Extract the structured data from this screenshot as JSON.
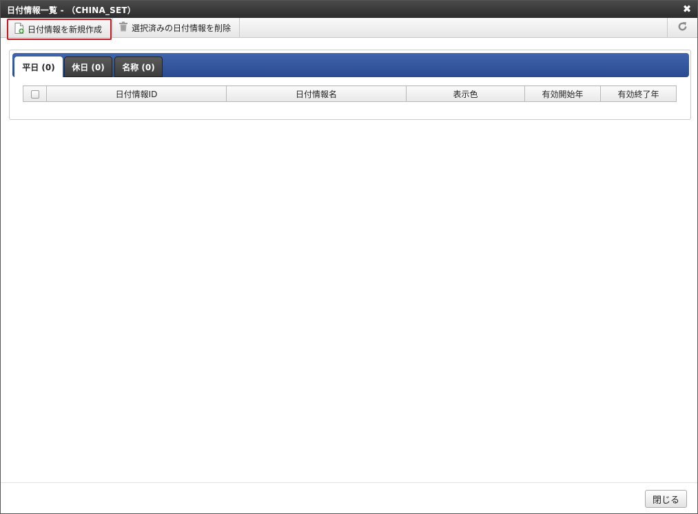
{
  "window": {
    "title": "日付情報一覧 - （CHINA_SET）",
    "close_icon": "close-icon"
  },
  "toolbar": {
    "new_label": "日付情報を新規作成",
    "new_icon": "new-document-icon",
    "delete_label": "選択済みの日付情報を削除",
    "delete_icon": "trash-icon",
    "refresh_icon": "refresh-icon",
    "highlight_color": "#c8161d"
  },
  "tabs": [
    {
      "label": "平日 (0)",
      "active": true
    },
    {
      "label": "休日 (0)",
      "active": false
    },
    {
      "label": "名称 (0)",
      "active": false
    }
  ],
  "table": {
    "columns": [
      "日付情報ID",
      "日付情報名",
      "表示色",
      "有効開始年",
      "有効終了年"
    ],
    "rows": []
  },
  "footer": {
    "close_label": "閉じる"
  },
  "colors": {
    "tabbar": "#2f52a0",
    "titlebar": "#333333"
  }
}
